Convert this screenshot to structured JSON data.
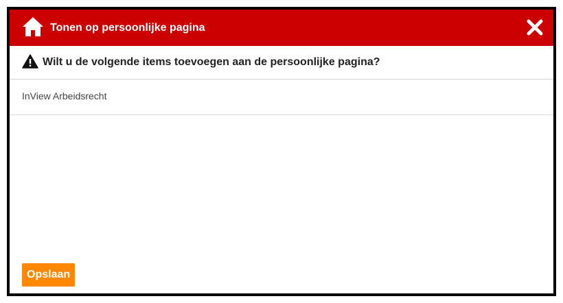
{
  "dialog": {
    "title": "Tonen op persoonlijke pagina",
    "title_icon": "home-icon",
    "close_icon": "close-icon",
    "question_icon": "warning-icon",
    "question": "Wilt u de volgende items toevoegen aan de persoonlijke pagina?",
    "items": [
      "InView Arbeidsrecht"
    ],
    "save_label": "Opslaan"
  },
  "colors": {
    "header": "#cc0000",
    "save_button": "#ff8800",
    "border": "#000000"
  }
}
